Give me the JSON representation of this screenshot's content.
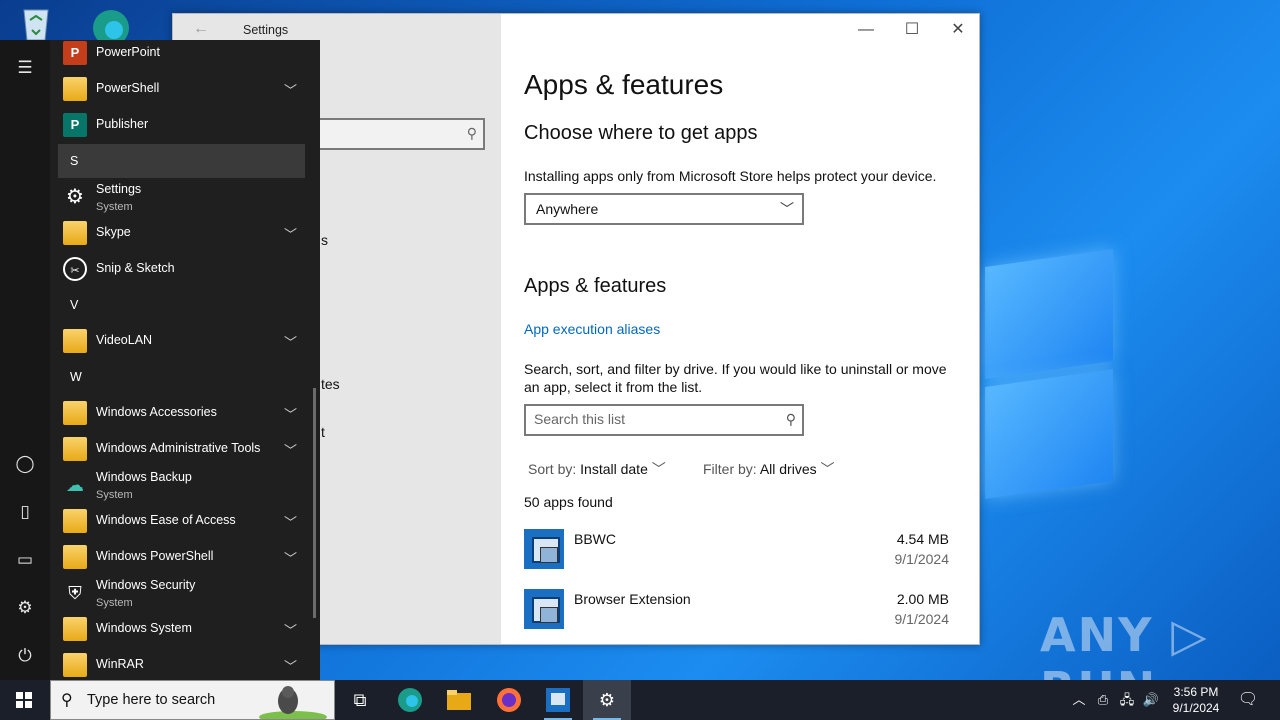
{
  "settings": {
    "window_title": "Settings",
    "controls": {
      "minimize": "—",
      "maximize": "☐",
      "close": "✕"
    },
    "left_fragments": [
      "s",
      "tes",
      "t"
    ],
    "page_title": "Apps & features",
    "choose_heading": "Choose where to get apps",
    "choose_desc": "Installing apps only from Microsoft Store helps protect your device.",
    "source_dropdown_value": "Anywhere",
    "section_heading": "Apps & features",
    "aliases_link": "App execution aliases",
    "search_desc": "Search, sort, and filter by drive. If you would like to uninstall or move an app, select it from the list.",
    "search_placeholder": "Search this list",
    "sort_label": "Sort by:",
    "sort_value": "Install date",
    "filter_label": "Filter by:",
    "filter_value": "All drives",
    "apps_count": "50 apps found",
    "apps": [
      {
        "name": "BBWC",
        "size": "4.54 MB",
        "date": "9/1/2024"
      },
      {
        "name": "Browser Extension",
        "size": "2.00 MB",
        "date": "9/1/2024"
      }
    ]
  },
  "start_menu": {
    "items": [
      {
        "label": "PowerPoint"
      },
      {
        "label": "PowerShell"
      },
      {
        "label": "Publisher"
      },
      {
        "letter": "S"
      },
      {
        "label": "Settings",
        "sub": "System"
      },
      {
        "label": "Skype"
      },
      {
        "label": "Snip & Sketch"
      },
      {
        "letter": "V"
      },
      {
        "label": "VideoLAN"
      },
      {
        "letter": "W"
      },
      {
        "label": "Windows Accessories"
      },
      {
        "label": "Windows Administrative Tools"
      },
      {
        "label": "Windows Backup",
        "sub": "System"
      },
      {
        "label": "Windows Ease of Access"
      },
      {
        "label": "Windows PowerShell"
      },
      {
        "label": "Windows Security",
        "sub": "System"
      },
      {
        "label": "Windows System"
      },
      {
        "label": "WinRAR"
      }
    ]
  },
  "taskbar": {
    "search_placeholder": "Type here to search",
    "time": "3:56 PM",
    "date": "9/1/2024"
  },
  "watermark": "ANY ▷ RUN"
}
